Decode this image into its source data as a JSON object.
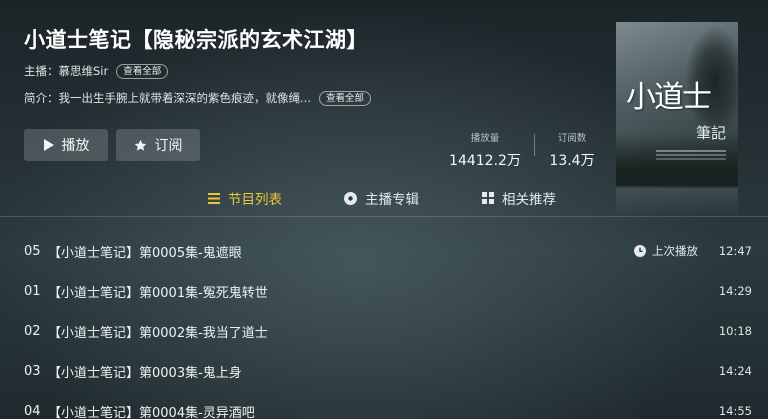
{
  "program": {
    "title": "小道士笔记【隐秘宗派的玄术江湖】",
    "host_label": "主播：",
    "host_name": "慕思维Sir",
    "view_all": "查看全部",
    "intro_label": "简介：",
    "intro_text": "我一出生手腕上就带着深深的紫色痕迹，就像绳...",
    "intro_view_all": "查看全部"
  },
  "actions": {
    "play": "播放",
    "subscribe": "订阅"
  },
  "stats": {
    "plays_label": "播放量",
    "plays_value": "14412.2万",
    "subs_label": "订阅数",
    "subs_value": "13.4万"
  },
  "cover": {
    "title": "小道士",
    "subtitle": "筆記"
  },
  "tabs": [
    {
      "label": "节目列表",
      "icon": "list-icon",
      "active": true
    },
    {
      "label": "主播专辑",
      "icon": "disc-icon",
      "active": false
    },
    {
      "label": "相关推荐",
      "icon": "grid-icon",
      "active": false
    }
  ],
  "episodes": [
    {
      "num": "05",
      "title": "【小道士笔记】第0005集-鬼遮眼",
      "duration": "12:47",
      "last_played": "上次播放"
    },
    {
      "num": "01",
      "title": "【小道士笔记】第0001集-冤死鬼转世",
      "duration": "14:29"
    },
    {
      "num": "02",
      "title": "【小道士笔记】第0002集-我当了道士",
      "duration": "10:18"
    },
    {
      "num": "03",
      "title": "【小道士笔记】第0003集-鬼上身",
      "duration": "14:24"
    },
    {
      "num": "04",
      "title": "【小道士笔记】第0004集-灵异酒吧",
      "duration": "14:55"
    }
  ],
  "colors": {
    "active_tab": "#e8c836",
    "background": "#263236"
  }
}
